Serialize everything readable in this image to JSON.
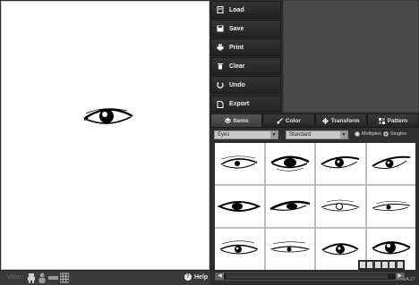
{
  "toolbar": {
    "buttons": [
      {
        "label": "Load",
        "icon": "load-icon"
      },
      {
        "label": "Save",
        "icon": "save-icon"
      },
      {
        "label": "Print",
        "icon": "print-icon"
      },
      {
        "label": "Clear",
        "icon": "trash-icon"
      },
      {
        "label": "Undo",
        "icon": "undo-icon"
      },
      {
        "label": "Export",
        "icon": "export-icon"
      }
    ]
  },
  "tabs": [
    {
      "label": "Items",
      "icon": "items-icon",
      "active": true
    },
    {
      "label": "Color",
      "icon": "brush-icon",
      "active": false
    },
    {
      "label": "Transform",
      "icon": "transform-icon",
      "active": false
    },
    {
      "label": "Pattern",
      "icon": "pattern-icon",
      "active": false
    }
  ],
  "filters": {
    "category": "Eyes",
    "style": "Standard",
    "radio_multiples": "Multiples",
    "radio_singles": "Singles",
    "selected": "Singles"
  },
  "bottombar": {
    "view_label": "View:",
    "help_label": "Help"
  },
  "version": "vA.27",
  "colors": {
    "panel_bg": "#2d2d2d",
    "preview_bg": "#4a4a4a",
    "canvas_bg": "#ffffff"
  }
}
